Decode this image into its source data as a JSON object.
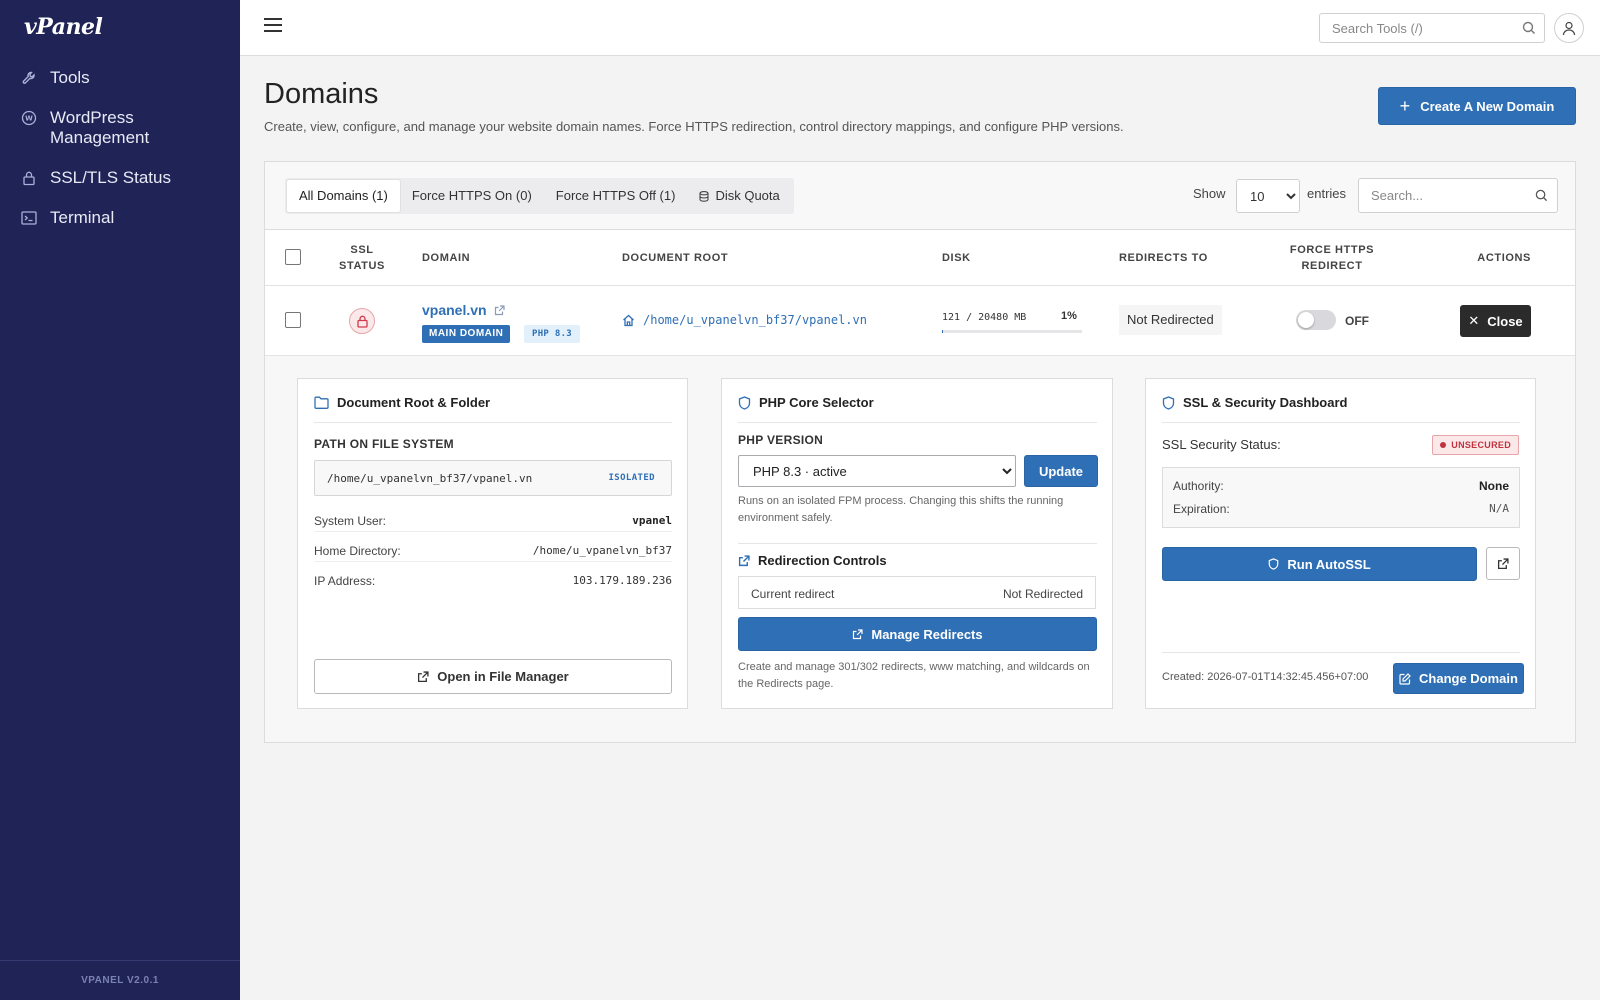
{
  "sidebar": {
    "logo": "vPanel",
    "items": [
      {
        "label": "Tools",
        "icon": "wrench-icon"
      },
      {
        "label": "WordPress Management",
        "icon": "wordpress-icon"
      },
      {
        "label": "SSL/TLS Status",
        "icon": "lock-icon"
      },
      {
        "label": "Terminal",
        "icon": "terminal-icon"
      }
    ],
    "version": "VPANEL V2.0.1"
  },
  "topbar": {
    "search_placeholder": "Search Tools (/)"
  },
  "page": {
    "title": "Domains",
    "description": "Create, view, configure, and manage your website domain names. Force HTTPS redirection, control directory mappings, and configure PHP versions.",
    "create_button": "Create A New Domain"
  },
  "filters": {
    "tabs": [
      {
        "label": "All Domains (1)",
        "active": true
      },
      {
        "label": "Force HTTPS On (0)",
        "active": false
      },
      {
        "label": "Force HTTPS Off (1)",
        "active": false
      },
      {
        "label": "Disk Quota",
        "active": false
      }
    ],
    "show_label": "Show",
    "entries_value": "10",
    "entries_label": "entries",
    "search_placeholder": "Search..."
  },
  "table": {
    "headers": {
      "ssl_status": "SSL STATUS",
      "domain": "DOMAIN",
      "document_root": "DOCUMENT ROOT",
      "disk": "DISK",
      "redirects_to": "REDIRECTS TO",
      "force_https": "FORCE HTTPS REDIRECT",
      "actions": "ACTIONS"
    },
    "rows": [
      {
        "domain": "vpanel.vn",
        "badge_main": "MAIN DOMAIN",
        "badge_php": "PHP 8.3",
        "document_root": "/home/u_vpanelvn_bf37/vpanel.vn",
        "disk_usage": "121 / 20480 MB",
        "disk_percent": "1%",
        "disk_fraction": 0.0059,
        "redirects_to": "Not Redirected",
        "force_https": "OFF",
        "action_label": "Close"
      }
    ]
  },
  "details": {
    "docroot_card": {
      "title": "Document Root & Folder",
      "path_label": "PATH ON FILE SYSTEM",
      "path_value": "/home/u_vpanelvn_bf37/vpanel.vn",
      "path_badge": "ISOLATED",
      "system_user_label": "System User:",
      "system_user_value": "vpanel",
      "home_dir_label": "Home Directory:",
      "home_dir_value": "/home/u_vpanelvn_bf37",
      "ip_label": "IP Address:",
      "ip_value": "103.179.189.236",
      "file_manager_button": "Open in File Manager"
    },
    "php_card": {
      "title": "PHP Core Selector",
      "version_label": "PHP VERSION",
      "version_value": "PHP 8.3 · active",
      "update_button": "Update",
      "help": "Runs on an isolated FPM process. Changing this shifts the running environment safely.",
      "redirect_title": "Redirection Controls",
      "current_redirect_label": "Current redirect",
      "current_redirect_value": "Not Redirected",
      "manage_button": "Manage Redirects",
      "redirect_help": "Create and manage 301/302 redirects, www matching, and wildcards on the Redirects page."
    },
    "ssl_card": {
      "title": "SSL & Security Dashboard",
      "status_label": "SSL Security Status:",
      "status_badge": "UNSECURED",
      "authority_label": "Authority:",
      "authority_value": "None",
      "expiration_label": "Expiration:",
      "expiration_value": "N/A",
      "autossl_button": "Run AutoSSL",
      "created_text": "Created: 2026-07-01T14:32:45.456+07:00",
      "change_domain_button": "Change Domain"
    }
  },
  "colors": {
    "sidebar_bg": "#1f2356",
    "accent": "#2f6fb5",
    "danger": "#c0323e"
  }
}
